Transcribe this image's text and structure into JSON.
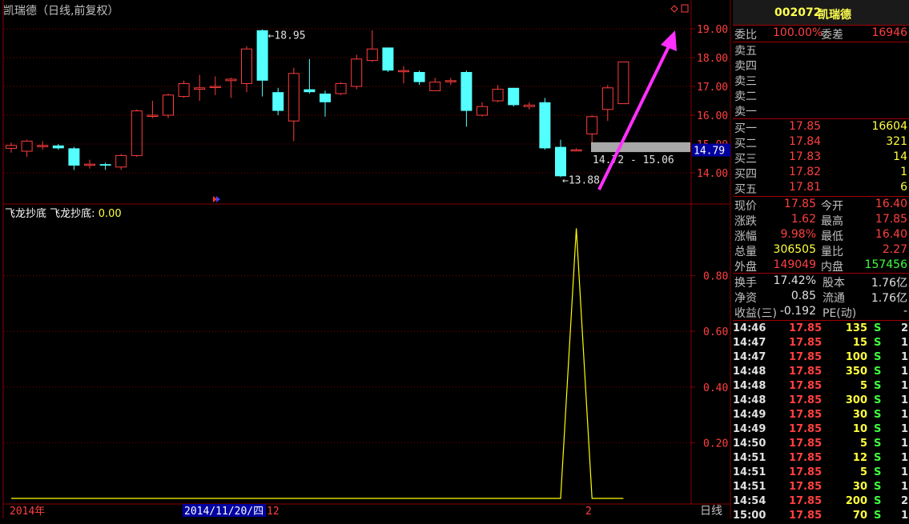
{
  "window": {
    "title": "凯瑞德（日线,前复权）"
  },
  "chart_data": {
    "type": "candlestick",
    "y_ticks": [
      "19.00",
      "18.00",
      "17.00",
      "16.00",
      "15.00",
      "14.00"
    ],
    "current_price_tag": "14.79",
    "high_annotation": "18.95",
    "low_annotation": "13.88",
    "range_annotation": "14.72 - 15.06",
    "indicator": {
      "name": "飞龙抄底",
      "label": "飞龙抄底:",
      "value": "0.00",
      "y_ticks": [
        "0.80",
        "0.60",
        "0.40",
        "0.20"
      ]
    },
    "date_labels": [
      "2014年",
      "2014/11/20/四",
      "12",
      "2"
    ],
    "period_label": "日线",
    "candles": [
      {
        "o": 14.85,
        "c": 14.95,
        "h": 15.05,
        "l": 14.7
      },
      {
        "o": 14.75,
        "c": 15.1,
        "h": 15.15,
        "l": 14.55
      },
      {
        "o": 14.95,
        "c": 14.95,
        "h": 15.1,
        "l": 14.8
      },
      {
        "o": 14.95,
        "c": 14.85,
        "h": 15.0,
        "l": 14.8
      },
      {
        "o": 14.85,
        "c": 14.25,
        "h": 14.9,
        "l": 14.1
      },
      {
        "o": 14.3,
        "c": 14.3,
        "h": 14.45,
        "l": 14.15
      },
      {
        "o": 14.3,
        "c": 14.25,
        "h": 14.35,
        "l": 14.1
      },
      {
        "o": 14.2,
        "c": 14.6,
        "h": 14.65,
        "l": 14.1
      },
      {
        "o": 14.6,
        "c": 16.15,
        "h": 16.2,
        "l": 14.55
      },
      {
        "o": 16.0,
        "c": 16.0,
        "h": 16.5,
        "l": 15.9
      },
      {
        "o": 16.0,
        "c": 16.7,
        "h": 16.75,
        "l": 15.9
      },
      {
        "o": 16.65,
        "c": 17.1,
        "h": 17.2,
        "l": 16.6
      },
      {
        "o": 16.9,
        "c": 16.95,
        "h": 17.4,
        "l": 16.5
      },
      {
        "o": 17.0,
        "c": 17.0,
        "h": 17.35,
        "l": 16.7
      },
      {
        "o": 17.2,
        "c": 17.25,
        "h": 17.3,
        "l": 16.6
      },
      {
        "o": 17.1,
        "c": 18.3,
        "h": 18.4,
        "l": 16.8
      },
      {
        "o": 18.95,
        "c": 17.2,
        "h": 18.98,
        "l": 16.65
      },
      {
        "o": 16.8,
        "c": 16.15,
        "h": 16.95,
        "l": 16.0
      },
      {
        "o": 15.8,
        "c": 17.45,
        "h": 17.65,
        "l": 15.1
      },
      {
        "o": 16.9,
        "c": 16.8,
        "h": 17.95,
        "l": 16.75
      },
      {
        "o": 16.75,
        "c": 16.45,
        "h": 16.85,
        "l": 15.95
      },
      {
        "o": 16.75,
        "c": 17.1,
        "h": 17.15,
        "l": 16.7
      },
      {
        "o": 17.0,
        "c": 17.95,
        "h": 18.1,
        "l": 16.9
      },
      {
        "o": 17.9,
        "c": 18.3,
        "h": 18.95,
        "l": 17.85
      },
      {
        "o": 18.35,
        "c": 17.55,
        "h": 18.35,
        "l": 17.5
      },
      {
        "o": 17.55,
        "c": 17.55,
        "h": 17.7,
        "l": 17.1
      },
      {
        "o": 17.5,
        "c": 17.15,
        "h": 17.55,
        "l": 17.05
      },
      {
        "o": 16.85,
        "c": 17.15,
        "h": 17.3,
        "l": 16.85
      },
      {
        "o": 17.2,
        "c": 17.2,
        "h": 17.3,
        "l": 17.05
      },
      {
        "o": 17.5,
        "c": 16.15,
        "h": 17.55,
        "l": 15.6
      },
      {
        "o": 16.0,
        "c": 16.3,
        "h": 16.45,
        "l": 15.95
      },
      {
        "o": 16.5,
        "c": 16.9,
        "h": 17.05,
        "l": 16.45
      },
      {
        "o": 16.95,
        "c": 16.35,
        "h": 16.95,
        "l": 16.3
      },
      {
        "o": 16.3,
        "c": 16.35,
        "h": 16.45,
        "l": 16.2
      },
      {
        "o": 16.45,
        "c": 14.85,
        "h": 16.6,
        "l": 14.8
      },
      {
        "o": 14.9,
        "c": 13.88,
        "h": 15.15,
        "l": 13.85
      },
      {
        "o": 14.8,
        "c": 14.8,
        "h": 14.85,
        "l": 14.75
      },
      {
        "o": 15.35,
        "c": 15.95,
        "h": 16.0,
        "l": 14.95
      },
      {
        "o": 16.2,
        "c": 16.95,
        "h": 17.05,
        "l": 15.8
      },
      {
        "o": 16.4,
        "c": 17.85,
        "h": 17.85,
        "l": 16.4
      }
    ],
    "indicator_values": [
      0,
      0,
      0,
      0,
      0,
      0,
      0,
      0,
      0,
      0,
      0,
      0,
      0,
      0,
      0,
      0,
      0,
      0,
      0,
      0,
      0,
      0,
      0,
      0,
      0,
      0,
      0,
      0,
      0,
      0,
      0,
      0,
      0,
      0,
      0,
      0,
      0.97,
      0,
      0,
      0
    ]
  },
  "panel": {
    "code": "002072",
    "name": "凯瑞德",
    "weibi": {
      "label": "委比",
      "value": "100.00%",
      "diff_label": "委差",
      "diff": "16946"
    },
    "asks": [
      {
        "label": "卖五",
        "price": "",
        "vol": ""
      },
      {
        "label": "卖四",
        "price": "",
        "vol": ""
      },
      {
        "label": "卖三",
        "price": "",
        "vol": ""
      },
      {
        "label": "卖二",
        "price": "",
        "vol": ""
      },
      {
        "label": "卖一",
        "price": "",
        "vol": ""
      }
    ],
    "bids": [
      {
        "label": "买一",
        "price": "17.85",
        "vol": "16604"
      },
      {
        "label": "买二",
        "price": "17.84",
        "vol": "321"
      },
      {
        "label": "买三",
        "price": "17.83",
        "vol": "14"
      },
      {
        "label": "买四",
        "price": "17.82",
        "vol": "1"
      },
      {
        "label": "买五",
        "price": "17.81",
        "vol": "6"
      }
    ],
    "stats": [
      {
        "l1": "现价",
        "v1": "17.85",
        "l2": "今开",
        "v2": "16.40",
        "c1": "red",
        "c2": "red"
      },
      {
        "l1": "涨跌",
        "v1": "1.62",
        "l2": "最高",
        "v2": "17.85",
        "c1": "red",
        "c2": "red"
      },
      {
        "l1": "涨幅",
        "v1": "9.98%",
        "l2": "最低",
        "v2": "16.40",
        "c1": "red",
        "c2": "red"
      },
      {
        "l1": "总量",
        "v1": "306505",
        "l2": "量比",
        "v2": "2.27",
        "c1": "yel",
        "c2": "red"
      },
      {
        "l1": "外盘",
        "v1": "149049",
        "l2": "内盘",
        "v2": "157456",
        "c1": "red",
        "c2": "grn"
      }
    ],
    "stats2": [
      {
        "l1": "换手",
        "v1": "17.42%",
        "l2": "股本",
        "v2": "1.76亿"
      },
      {
        "l1": "净资",
        "v1": "0.85",
        "l2": "流通",
        "v2": "1.76亿"
      },
      {
        "l1": "收益(三)",
        "v1": "-0.192",
        "l2": "PE(动)",
        "v2": "-"
      }
    ],
    "ticks": [
      {
        "t": "14:46",
        "p": "17.85",
        "v": "135",
        "s": "S",
        "n": "2"
      },
      {
        "t": "14:47",
        "p": "17.85",
        "v": "15",
        "s": "S",
        "n": "1"
      },
      {
        "t": "14:47",
        "p": "17.85",
        "v": "100",
        "s": "S",
        "n": "1"
      },
      {
        "t": "14:48",
        "p": "17.85",
        "v": "350",
        "s": "S",
        "n": "1"
      },
      {
        "t": "14:48",
        "p": "17.85",
        "v": "5",
        "s": "S",
        "n": "1"
      },
      {
        "t": "14:48",
        "p": "17.85",
        "v": "300",
        "s": "S",
        "n": "1"
      },
      {
        "t": "14:49",
        "p": "17.85",
        "v": "30",
        "s": "S",
        "n": "1"
      },
      {
        "t": "14:49",
        "p": "17.85",
        "v": "10",
        "s": "S",
        "n": "1"
      },
      {
        "t": "14:50",
        "p": "17.85",
        "v": "5",
        "s": "S",
        "n": "1"
      },
      {
        "t": "14:51",
        "p": "17.85",
        "v": "12",
        "s": "S",
        "n": "1"
      },
      {
        "t": "14:51",
        "p": "17.85",
        "v": "5",
        "s": "S",
        "n": "1"
      },
      {
        "t": "14:51",
        "p": "17.85",
        "v": "30",
        "s": "S",
        "n": "1"
      },
      {
        "t": "14:54",
        "p": "17.85",
        "v": "200",
        "s": "S",
        "n": "2"
      },
      {
        "t": "15:00",
        "p": "17.85",
        "v": "70",
        "s": "S",
        "n": "1"
      }
    ]
  },
  "colors": {
    "up": "#ff3c3c",
    "down": "#54ffff",
    "grid": "#880000",
    "indicator": "#ffff00",
    "arrow": "#ff30ff"
  }
}
